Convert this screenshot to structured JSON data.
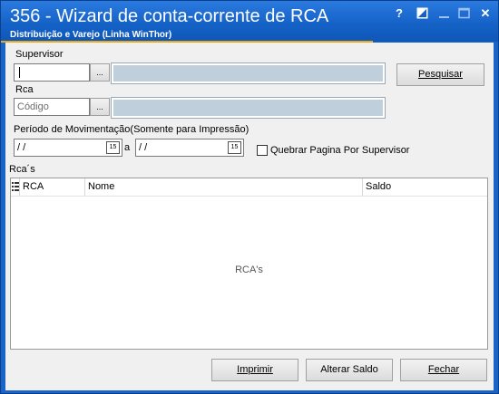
{
  "window": {
    "title": "356 - Wizard de conta-corrente de RCA",
    "subtitle": "Distribuição e Varejo (Linha WinThor)",
    "help_glyph": "?",
    "close_glyph": "✕"
  },
  "supervisor": {
    "label": "Supervisor",
    "code_value": "",
    "lookup_label": "...",
    "name_value": ""
  },
  "rca": {
    "label": "Rca",
    "code_placeholder": "Código",
    "lookup_label": "...",
    "name_value": ""
  },
  "periodo": {
    "label": "Período de Movimentação(Somente para Impressão)",
    "start_value": " / /",
    "end_value": " / /",
    "separator": "a",
    "calendar_icon_text": "15"
  },
  "quebrar_checkbox": {
    "label": "Quebrar Pagina Por Supervisor",
    "checked": false
  },
  "grid": {
    "title": "Rca´s",
    "columns": [
      "RCA",
      "Nome",
      "Saldo"
    ],
    "empty_text": "RCA's"
  },
  "buttons": {
    "pesquisar": "Pesquisar",
    "imprimir": "Imprimir",
    "alterar_saldo": "Alterar Saldo",
    "fechar": "Fechar"
  },
  "colors": {
    "titlebar": "#1461c6",
    "accent_underline": "#e9a91c",
    "readonly_field": "#bfcfdc"
  }
}
